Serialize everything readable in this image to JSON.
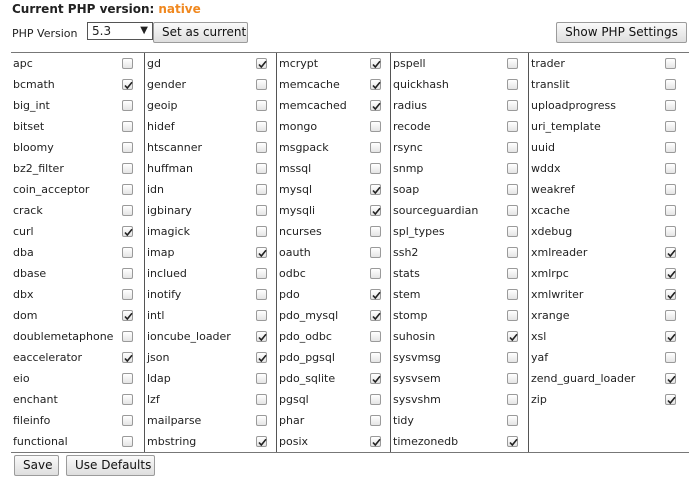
{
  "header": {
    "title": "Current PHP version:",
    "current_value": "native"
  },
  "version_selector": {
    "label": "PHP Version",
    "selected": "5.3"
  },
  "buttons": {
    "set_current": "Set as current",
    "show_settings": "Show PHP Settings",
    "save": "Save",
    "use_defaults": "Use Defaults"
  },
  "extensions": [
    [
      {
        "name": "apc",
        "checked": false
      },
      {
        "name": "bcmath",
        "checked": true
      },
      {
        "name": "big_int",
        "checked": false
      },
      {
        "name": "bitset",
        "checked": false
      },
      {
        "name": "bloomy",
        "checked": false
      },
      {
        "name": "bz2_filter",
        "checked": false
      },
      {
        "name": "coin_acceptor",
        "checked": false
      },
      {
        "name": "crack",
        "checked": false
      },
      {
        "name": "curl",
        "checked": true
      },
      {
        "name": "dba",
        "checked": false
      },
      {
        "name": "dbase",
        "checked": false
      },
      {
        "name": "dbx",
        "checked": false
      },
      {
        "name": "dom",
        "checked": true
      },
      {
        "name": "doublemetaphone",
        "checked": false
      },
      {
        "name": "eaccelerator",
        "checked": true
      },
      {
        "name": "eio",
        "checked": false
      },
      {
        "name": "enchant",
        "checked": false
      },
      {
        "name": "fileinfo",
        "checked": false
      },
      {
        "name": "functional",
        "checked": false
      }
    ],
    [
      {
        "name": "gd",
        "checked": true
      },
      {
        "name": "gender",
        "checked": false
      },
      {
        "name": "geoip",
        "checked": false
      },
      {
        "name": "hidef",
        "checked": false
      },
      {
        "name": "htscanner",
        "checked": false
      },
      {
        "name": "huffman",
        "checked": false
      },
      {
        "name": "idn",
        "checked": false
      },
      {
        "name": "igbinary",
        "checked": false
      },
      {
        "name": "imagick",
        "checked": false
      },
      {
        "name": "imap",
        "checked": true
      },
      {
        "name": "inclued",
        "checked": false
      },
      {
        "name": "inotify",
        "checked": false
      },
      {
        "name": "intl",
        "checked": false
      },
      {
        "name": "ioncube_loader",
        "checked": true
      },
      {
        "name": "json",
        "checked": true
      },
      {
        "name": "ldap",
        "checked": false
      },
      {
        "name": "lzf",
        "checked": false
      },
      {
        "name": "mailparse",
        "checked": false
      },
      {
        "name": "mbstring",
        "checked": true
      }
    ],
    [
      {
        "name": "mcrypt",
        "checked": true
      },
      {
        "name": "memcache",
        "checked": true
      },
      {
        "name": "memcached",
        "checked": true
      },
      {
        "name": "mongo",
        "checked": false
      },
      {
        "name": "msgpack",
        "checked": false
      },
      {
        "name": "mssql",
        "checked": false
      },
      {
        "name": "mysql",
        "checked": true
      },
      {
        "name": "mysqli",
        "checked": true
      },
      {
        "name": "ncurses",
        "checked": false
      },
      {
        "name": "oauth",
        "checked": false
      },
      {
        "name": "odbc",
        "checked": false
      },
      {
        "name": "pdo",
        "checked": true
      },
      {
        "name": "pdo_mysql",
        "checked": true
      },
      {
        "name": "pdo_odbc",
        "checked": false
      },
      {
        "name": "pdo_pgsql",
        "checked": false
      },
      {
        "name": "pdo_sqlite",
        "checked": true
      },
      {
        "name": "pgsql",
        "checked": false
      },
      {
        "name": "phar",
        "checked": false
      },
      {
        "name": "posix",
        "checked": true
      }
    ],
    [
      {
        "name": "pspell",
        "checked": false
      },
      {
        "name": "quickhash",
        "checked": false
      },
      {
        "name": "radius",
        "checked": false
      },
      {
        "name": "recode",
        "checked": false
      },
      {
        "name": "rsync",
        "checked": false
      },
      {
        "name": "snmp",
        "checked": false
      },
      {
        "name": "soap",
        "checked": false
      },
      {
        "name": "sourceguardian",
        "checked": false
      },
      {
        "name": "spl_types",
        "checked": false
      },
      {
        "name": "ssh2",
        "checked": false
      },
      {
        "name": "stats",
        "checked": false
      },
      {
        "name": "stem",
        "checked": false
      },
      {
        "name": "stomp",
        "checked": false
      },
      {
        "name": "suhosin",
        "checked": true
      },
      {
        "name": "sysvmsg",
        "checked": false
      },
      {
        "name": "sysvsem",
        "checked": false
      },
      {
        "name": "sysvshm",
        "checked": false
      },
      {
        "name": "tidy",
        "checked": false
      },
      {
        "name": "timezonedb",
        "checked": true
      }
    ],
    [
      {
        "name": "trader",
        "checked": false
      },
      {
        "name": "translit",
        "checked": false
      },
      {
        "name": "uploadprogress",
        "checked": false
      },
      {
        "name": "uri_template",
        "checked": false
      },
      {
        "name": "uuid",
        "checked": false
      },
      {
        "name": "wddx",
        "checked": false
      },
      {
        "name": "weakref",
        "checked": false
      },
      {
        "name": "xcache",
        "checked": false
      },
      {
        "name": "xdebug",
        "checked": false
      },
      {
        "name": "xmlreader",
        "checked": true
      },
      {
        "name": "xmlrpc",
        "checked": true
      },
      {
        "name": "xmlwriter",
        "checked": true
      },
      {
        "name": "xrange",
        "checked": false
      },
      {
        "name": "xsl",
        "checked": true
      },
      {
        "name": "yaf",
        "checked": false
      },
      {
        "name": "zend_guard_loader",
        "checked": true
      },
      {
        "name": "zip",
        "checked": true
      }
    ]
  ]
}
